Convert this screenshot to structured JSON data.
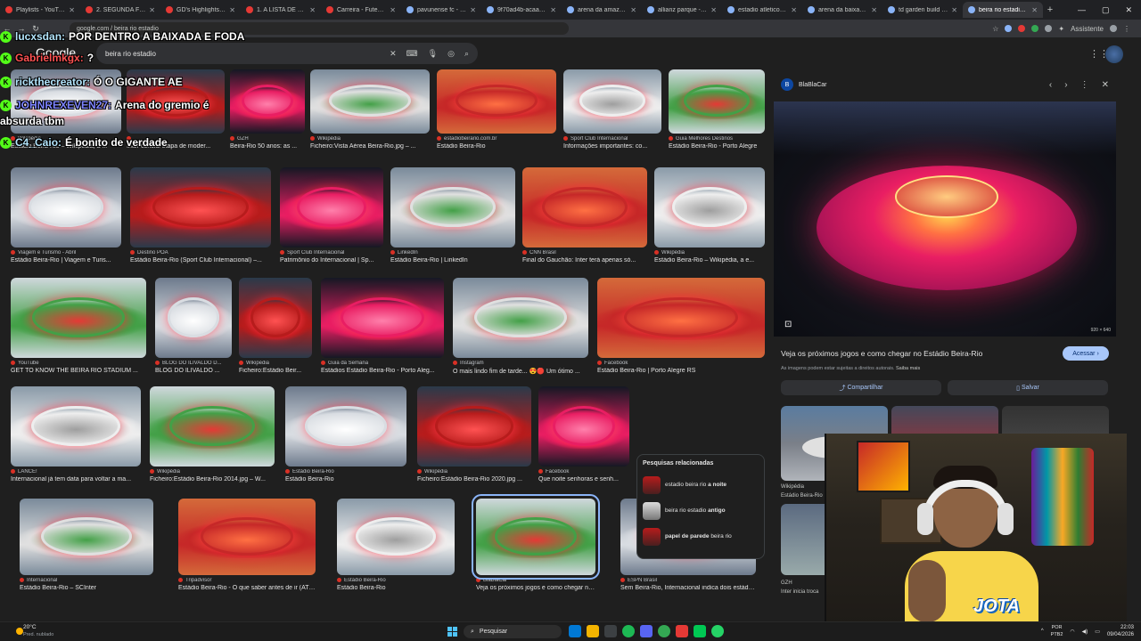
{
  "browser": {
    "tabs": [
      {
        "label": "Playlists - YouTube",
        "icon": "youtube-icon"
      },
      {
        "label": "2. SEGUNDA FEIRA",
        "icon": "youtube-icon"
      },
      {
        "label": "GD's Highlights - You",
        "icon": "youtube-icon"
      },
      {
        "label": "1. A LISTA DE VIDEOS",
        "icon": "youtube-icon"
      },
      {
        "label": "Carreira - Futebol - M",
        "icon": "youtube-icon"
      },
      {
        "label": "pavunense fc - Pesq",
        "icon": "google-icon"
      },
      {
        "label": "9f70ad4b-acaa-405",
        "icon": "google-icon"
      },
      {
        "label": "arena da amazona - ",
        "icon": "google-icon"
      },
      {
        "label": "allianz parque - Pesq",
        "icon": "google-icon"
      },
      {
        "label": "estadio atletico mine",
        "icon": "google-icon"
      },
      {
        "label": "arena da baixada - P",
        "icon": "google-icon"
      },
      {
        "label": "td garden build - Pes",
        "icon": "google-icon"
      },
      {
        "label": "beira rio estadio - Pe",
        "icon": "google-icon"
      }
    ],
    "url": "google.com / beira rio estadio",
    "assistant_label": "Assistente"
  },
  "google": {
    "logo_text": "Google",
    "search_value": "beira rio estadio"
  },
  "results": [
    {
      "source": "Wikipédia",
      "title": "Estádio Beira-Rio – Wikipédia, a ..."
    },
    {
      "source": "",
      "title": "Inter conclui etapa de moder..."
    },
    {
      "source": "GZH",
      "title": "Beira-Rio 50 anos: as ..."
    },
    {
      "source": "Wikipédia",
      "title": "Ficheiro:Vista Aérea Beira-Rio.jpg – ..."
    },
    {
      "source": "estadiobeirario.com.br",
      "title": "Estádio Beira-Rio"
    },
    {
      "source": "Sport Club Internacional",
      "title": "Informações importantes: co..."
    },
    {
      "source": "Guia Melhores Destinos",
      "title": "Estádio Beira-Rio - Porto Alegre"
    },
    {
      "source": "Viagem e Turismo - Abril",
      "title": "Estádio Beira-Rio | Viagem e Turis..."
    },
    {
      "source": "Destino POA",
      "title": "Estádio Beira-Rio (Sport Club Internacional) –..."
    },
    {
      "source": "Sport Club Internacional",
      "title": "Patrimônio do Internacional | Sp..."
    },
    {
      "source": "LinkedIn",
      "title": "Estádio Beira-Rio | LinkedIn"
    },
    {
      "source": "CNN Brasil",
      "title": "Final do Gauchão: Inter terá apenas só..."
    },
    {
      "source": "Wikipédia",
      "title": "Estádio Beira-Rio – Wikipédia, a e..."
    },
    {
      "source": "YouTube",
      "title": "GET TO KNOW THE BEIRA RIO STADIUM ..."
    },
    {
      "source": "BLOG DO ILIVALDO D...",
      "title": "BLOG DO ILIVALDO ..."
    },
    {
      "source": "Wikipédia",
      "title": "Ficheiro:Estádio Beir..."
    },
    {
      "source": "Guia da Semana",
      "title": "Estádios Estádio Beira-Rio - Porto Aleg..."
    },
    {
      "source": "Instagram",
      "title": "O mais lindo fim de tarde... 😍🔴 Um ótimo ..."
    },
    {
      "source": "Facebook",
      "title": "Estádio Beira-Rio | Porto Alegre RS"
    },
    {
      "source": "LANCE!",
      "title": "Internacional já tem data para voltar a ma..."
    },
    {
      "source": "Wikipédia",
      "title": "Ficheiro:Estádio Beira-Rio 2014.jpg – W..."
    },
    {
      "source": "Estádio Beira-Rio",
      "title": "Estádio Beira-Rio"
    },
    {
      "source": "Wikipédia",
      "title": "Ficheiro:Estádio Beira-Rio 2020.jpg ..."
    },
    {
      "source": "Facebook",
      "title": "Que noite senhoras e senh..."
    },
    {
      "source": "Internacional",
      "title": "Estádio Beira-Rio – SCInter"
    },
    {
      "source": "Tripadvisor",
      "title": "Estádio Beira-Rio - O que saber antes de ir (ATU..."
    },
    {
      "source": "Estádio Beira-Rio",
      "title": "Estádio Beira-Rio"
    },
    {
      "source": "BlaBlaCar",
      "title": "Veja os próximos jogos e como chegar no E..."
    },
    {
      "source": "ESPN Brasil",
      "title": "Sem Beira-Rio, Internacional indica dois estádios..."
    }
  ],
  "related": {
    "heading": "Pesquisas relacionadas",
    "items": [
      {
        "prefix": "estadio beira rio",
        "bold": "a noite"
      },
      {
        "prefix": "beira rio estadio",
        "bold": "antigo"
      },
      {
        "prefix": "papel de parede",
        "bold": "beira rio"
      }
    ]
  },
  "panel": {
    "source": "BlaBlaCar",
    "logo_letter": "B",
    "dimensions": "920 × 640",
    "title": "Veja os próximos jogos e como chegar no Estádio Beira-Rio",
    "visit_label": "Acessar",
    "disclaimer": "As imagens podem estar sujeitas a direitos autorais.",
    "learn_more": "Saiba mais",
    "share_label": "Compartilhar",
    "save_label": "Salvar",
    "more_sources": [
      "Wikipédia",
      "GZH"
    ],
    "more_titles": [
      "Estádio Beira-Rio",
      "Inter inicia troca"
    ]
  },
  "chat": [
    {
      "user": "lucxsdan:",
      "text": "POR DENTRO A BAIXADA E FODA",
      "color": "blue"
    },
    {
      "user": "Gabrielmkgx:",
      "text": "?",
      "color": "red"
    },
    {
      "user": "rickthecreator:",
      "text": "Ó O GIGANTE AE",
      "color": "blue"
    },
    {
      "user": "JOHNREXEVEN27:",
      "text": "Arena do gremio é",
      "cont": "absurda tbm",
      "color": "purple"
    },
    {
      "user": "C4_Caio:",
      "text": "É bonito de verdade",
      "color": "blue"
    }
  ],
  "chat_badge": "K",
  "webcam": {
    "brand": "JOTA"
  },
  "taskbar": {
    "weather_temp": "20°C",
    "weather_desc": "Pred. nublado",
    "search_label": "Pesquisar",
    "lang_top": "POR",
    "lang_bottom": "PTB2",
    "time": "22:03",
    "date": "09/04/2026"
  },
  "colors": {
    "accent": "#a8c7fa",
    "chat_badge": "#53fc18",
    "selected_outline": "#8ab4f8"
  }
}
